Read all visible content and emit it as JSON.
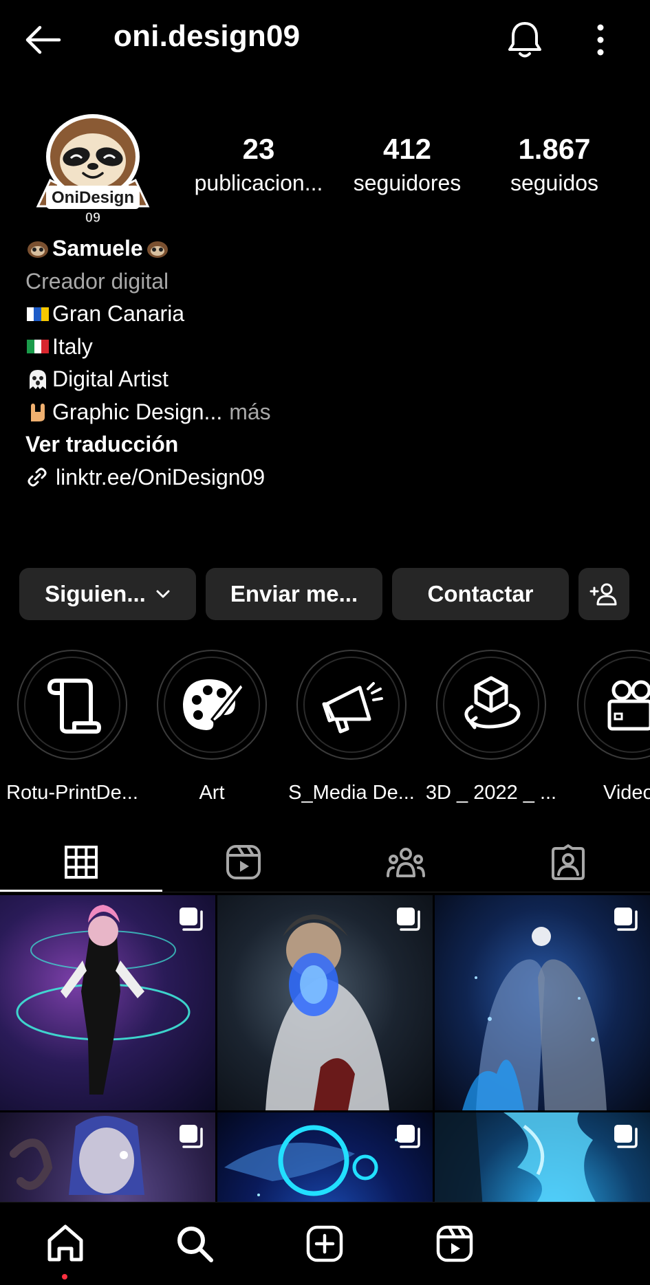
{
  "header": {
    "username": "oni.design09",
    "back_icon": "back-arrow-icon",
    "bell_icon": "bell-icon",
    "more_icon": "more-vertical-icon"
  },
  "avatar": {
    "logo_text": "OniDesign",
    "logo_sub": "09"
  },
  "stats": [
    {
      "count": "23",
      "label": "publicacion..."
    },
    {
      "count": "412",
      "label": "seguidores"
    },
    {
      "count": "1.867",
      "label": "seguidos"
    }
  ],
  "bio": {
    "name": "Samuele",
    "category": "Creador digital",
    "lines": [
      {
        "text": "Gran Canaria",
        "icon": "canary-flag-emoji"
      },
      {
        "text": "Italy",
        "icon": "italy-flag-emoji"
      },
      {
        "text": "Digital Artist",
        "icon": "ghost-emoji"
      },
      {
        "text": "Graphic Design...",
        "icon": "rock-hand-emoji"
      }
    ],
    "more_label": "más",
    "translate_label": "Ver traducción",
    "link": "linktr.ee/OniDesign09"
  },
  "actions": {
    "following_label": "Siguien...",
    "message_label": "Enviar me...",
    "contact_label": "Contactar",
    "add_user_icon": "add-person-icon"
  },
  "highlights": [
    {
      "label": "Rotu-PrintDe...",
      "icon": "scroll-icon"
    },
    {
      "label": "Art",
      "icon": "palette-icon"
    },
    {
      "label": "S_Media De...",
      "icon": "megaphone-icon"
    },
    {
      "label": "3D _ 2022 _ ...",
      "icon": "cube-icon"
    },
    {
      "label": "Video",
      "icon": "video-camera-icon"
    }
  ],
  "tabs": [
    {
      "icon": "grid-icon",
      "active": true
    },
    {
      "icon": "reels-icon",
      "active": false
    },
    {
      "icon": "collab-icon",
      "active": false
    },
    {
      "icon": "tagged-icon",
      "active": false
    }
  ],
  "bottom_nav": [
    {
      "icon": "home-icon",
      "active": true
    },
    {
      "icon": "search-icon",
      "active": false
    },
    {
      "icon": "create-icon",
      "active": false
    },
    {
      "icon": "reels-icon",
      "active": false
    }
  ],
  "colors": {
    "background": "#000000",
    "button_bg": "#262626",
    "secondary_text": "#a8a8a8",
    "notification_dot": "#ff3040"
  }
}
